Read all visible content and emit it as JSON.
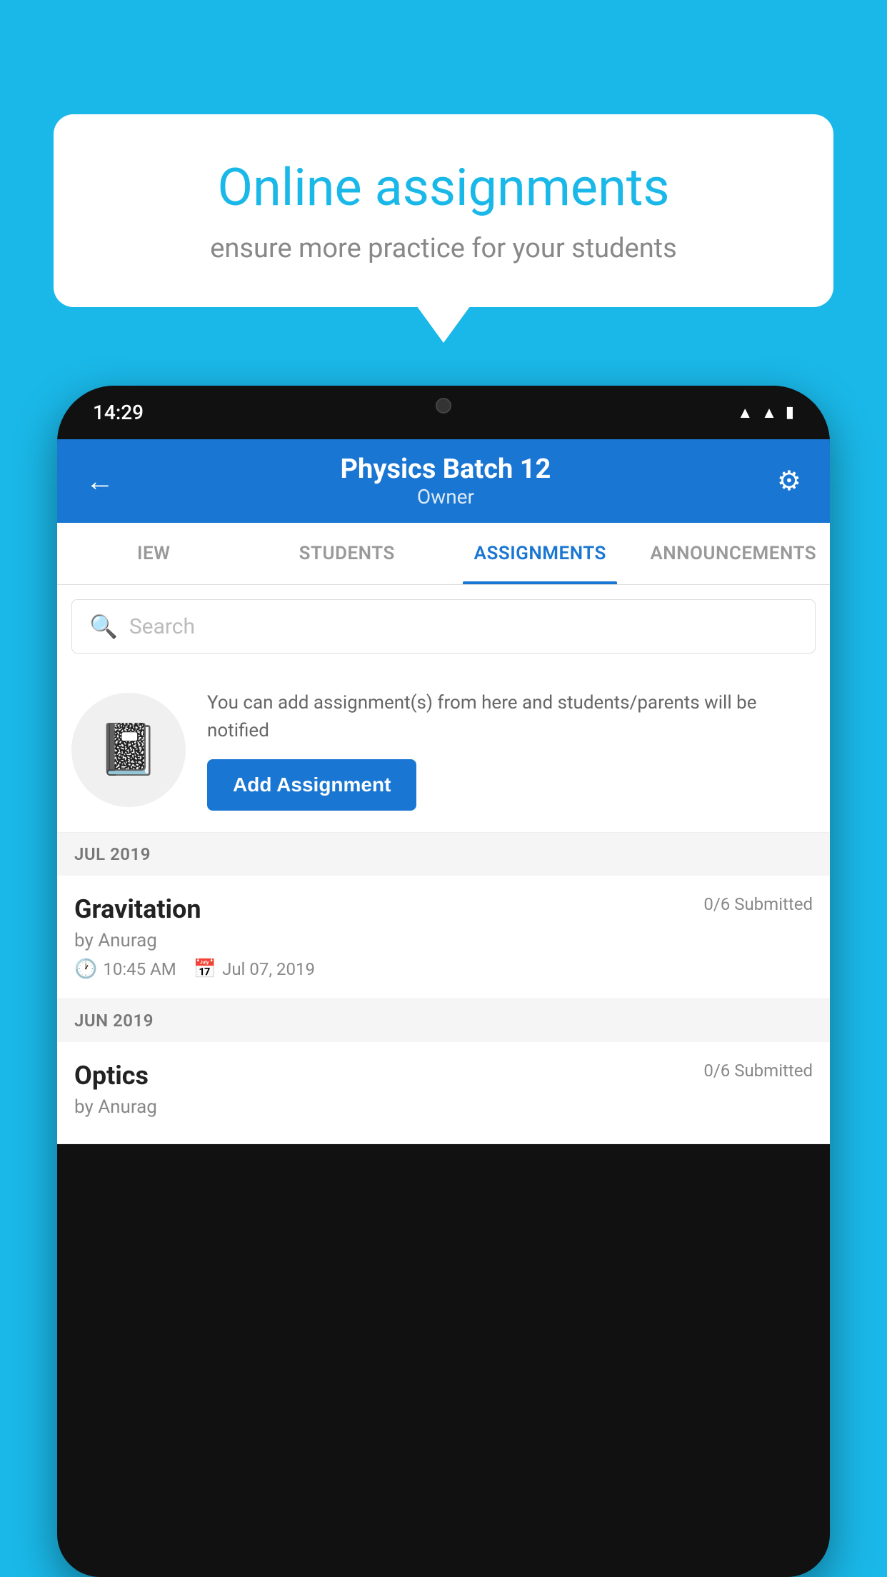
{
  "background_color": "#1ab8e8",
  "speech_bubble": {
    "title": "Online assignments",
    "subtitle": "ensure more practice for your students"
  },
  "phone": {
    "status_bar": {
      "time": "14:29",
      "icons": [
        "wifi",
        "signal",
        "battery"
      ]
    },
    "header": {
      "title": "Physics Batch 12",
      "subtitle": "Owner",
      "back_label": "←",
      "settings_label": "⚙"
    },
    "tabs": [
      {
        "label": "IEW",
        "active": false
      },
      {
        "label": "STUDENTS",
        "active": false
      },
      {
        "label": "ASSIGNMENTS",
        "active": true
      },
      {
        "label": "ANNOUNCEMENTS",
        "active": false
      }
    ],
    "search": {
      "placeholder": "Search"
    },
    "empty_state": {
      "description": "You can add assignment(s) from here and students/parents will be notified",
      "button_label": "Add Assignment"
    },
    "sections": [
      {
        "month": "JUL 2019",
        "assignments": [
          {
            "title": "Gravitation",
            "submitted": "0/6 Submitted",
            "author": "by Anurag",
            "time": "10:45 AM",
            "date": "Jul 07, 2019"
          }
        ]
      },
      {
        "month": "JUN 2019",
        "assignments": [
          {
            "title": "Optics",
            "submitted": "0/6 Submitted",
            "author": "by Anurag",
            "time": "",
            "date": ""
          }
        ]
      }
    ]
  }
}
